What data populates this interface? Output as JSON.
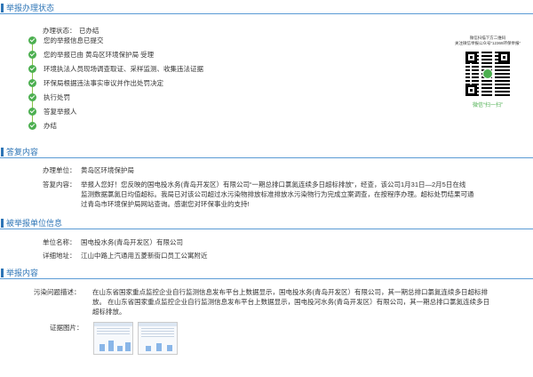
{
  "sections": {
    "status": "举报办理状态",
    "reply": "答复内容",
    "reported": "被举报单位信息",
    "report": "举报内容"
  },
  "status": {
    "label": "办理状态：",
    "value": "已办结",
    "steps": [
      "您的举报信息已提交",
      "您的举报已由 黄岛区环境保护局 受理",
      "环境执法人员现场调查取证、采样监测、收集违法证据",
      "环保局根据违法事实审议并作出处罚决定",
      "执行处罚",
      "答复举报人",
      "办结"
    ]
  },
  "qr": {
    "caption_line1": "微信扫描下方二维码",
    "caption_line2": "关注微信举报公众号“12369环保举报”",
    "wechat_label": "微信“扫一扫”"
  },
  "reply": {
    "unit_label": "办理单位：",
    "unit_value": "黄岛区环境保护局",
    "content_label": "答复内容：",
    "content_lines": [
      "举报人您好！您反映的国电投水务(青岛开发区）有限公司“一期总排口氯氮连续多日超标排放”，经查，该公司1月31日—2月5日在线",
      "监测数据氯氮日均值超标。我局已对该公司超过水污染物排放标准排放水污染物行为完成立案调查，在按程序办理。超标处罚结果可通",
      "过青岛市环境保护局网站查询。感谢您对环保事业的支持!"
    ]
  },
  "reported": {
    "name_label": "单位名称：",
    "name_value": "国电投水务(青岛开发区）有限公司",
    "address_label": "详细地址：",
    "address_value": "江山中路上汽通用五菱新街口员工公寓附近"
  },
  "report": {
    "pollution_label": "污染问题描述：",
    "pollution_lines": [
      "在山东省国家重点监控企业自行监测信息发布平台上数据显示，国电投水务(青岛开发区）有限公司，其一期总排口氯氮连续多日超标排",
      "放。  在山东省国家重点监控企业自行监测信息发布平台上数据显示，国电投河水务(青岛开发区）有限公司，其一期总排口氯氮连续多日",
      "超标排放。"
    ],
    "evidence_label": "证据图片："
  }
}
